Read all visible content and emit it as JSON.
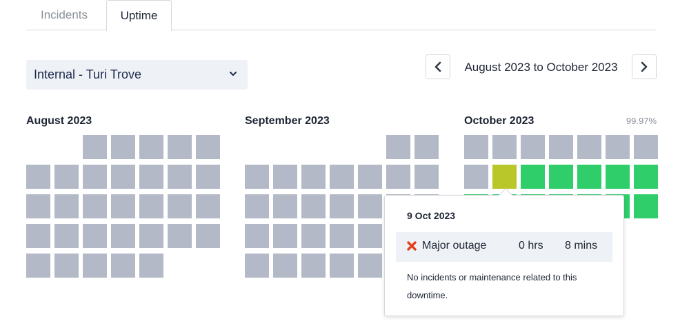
{
  "tabs": [
    {
      "label": "Incidents",
      "active": false
    },
    {
      "label": "Uptime",
      "active": true
    }
  ],
  "component_select": {
    "value": "Internal - Turi Trove"
  },
  "date_range": {
    "label": "August 2023 to October 2023"
  },
  "colors": {
    "no_data": "#b3b9c6",
    "operational": "#2fce6b",
    "major_outage_day": "#b9c72a",
    "outage_icon": "#e2401c"
  },
  "months": [
    {
      "title": "August 2023",
      "first_weekday": 2,
      "day_count": 31,
      "days_status": [
        "none",
        "none",
        "none",
        "none",
        "none",
        "none",
        "none",
        "none",
        "none",
        "none",
        "none",
        "none",
        "none",
        "none",
        "none",
        "none",
        "none",
        "none",
        "none",
        "none",
        "none",
        "none",
        "none",
        "none",
        "none",
        "none",
        "none",
        "none",
        "none",
        "none",
        "none"
      ]
    },
    {
      "title": "September 2023",
      "first_weekday": 5,
      "day_count": 30,
      "days_status": [
        "none",
        "none",
        "none",
        "none",
        "none",
        "none",
        "none",
        "none",
        "none",
        "none",
        "none",
        "none",
        "none",
        "none",
        "none",
        "none",
        "none",
        "none",
        "none",
        "none",
        "none",
        "none",
        "none",
        "none",
        "none",
        "none",
        "none",
        "none",
        "none",
        "none"
      ]
    },
    {
      "title": "October 2023",
      "uptime": "99.97%",
      "first_weekday": 0,
      "day_count": 21,
      "days_status": [
        "none",
        "none",
        "none",
        "none",
        "none",
        "none",
        "none",
        "none",
        "outage",
        "up",
        "up",
        "up",
        "up",
        "up",
        "up",
        "up",
        "up",
        "up",
        "up",
        "up",
        "up"
      ]
    }
  ],
  "tooltip": {
    "date": "9 Oct 2023",
    "status": "Major outage",
    "hours": "0 hrs",
    "minutes": "8 mins",
    "note": "No incidents or maintenance related to this downtime."
  }
}
